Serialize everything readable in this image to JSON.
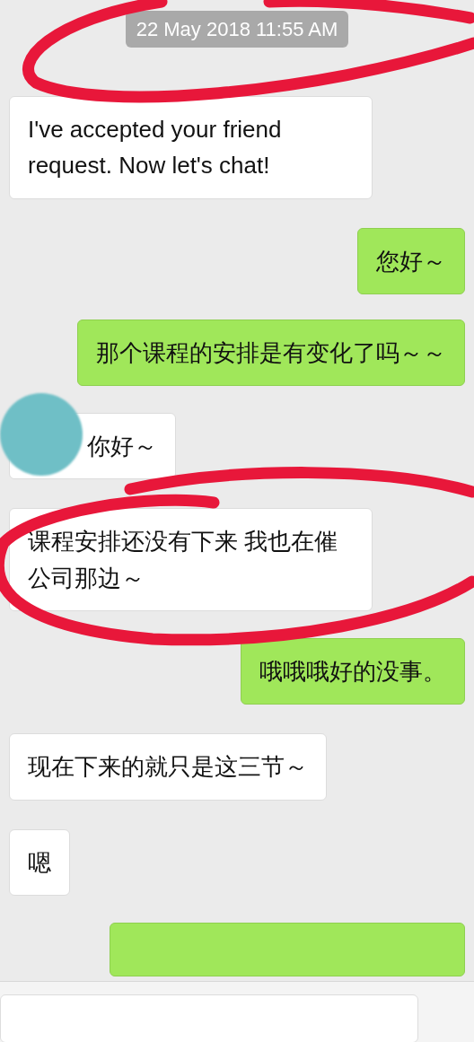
{
  "timestamp": "22 May 2018 11:55 AM",
  "messages": [
    {
      "kind": "incoming",
      "text": "I've accepted your friend request. Now let's chat!"
    },
    {
      "kind": "outgoing",
      "text": "您好～"
    },
    {
      "kind": "outgoing",
      "text": "那个课程的安排是有变化了吗～～"
    },
    {
      "kind": "incoming",
      "text": "你好～",
      "covered": true
    },
    {
      "kind": "incoming",
      "text": "课程安排还没有下来 我也在催公司那边～"
    },
    {
      "kind": "outgoing",
      "text": "哦哦哦好的没事。"
    },
    {
      "kind": "incoming",
      "text": "现在下来的就只是这三节～"
    },
    {
      "kind": "incoming",
      "text": "嗯"
    },
    {
      "kind": "outgoing",
      "cut": true
    }
  ]
}
